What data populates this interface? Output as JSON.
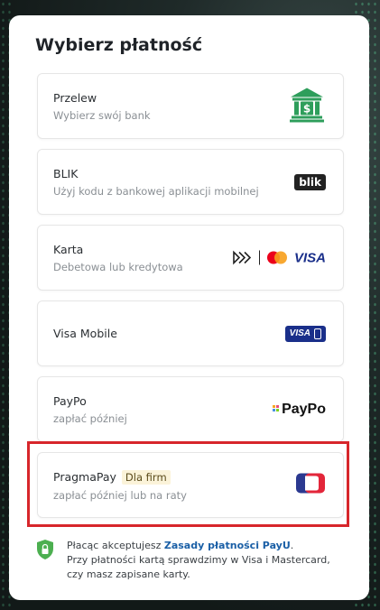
{
  "page": {
    "title": "Wybierz płatność"
  },
  "options": [
    {
      "name": "Przelew",
      "description": "Wybierz swój bank",
      "logo": "bank-icon"
    },
    {
      "name": "BLIK",
      "description": "Użyj kodu z bankowej aplikacji mobilnej",
      "logo": "blik-logo",
      "logo_text": "blik"
    },
    {
      "name": "Karta",
      "description": "Debetowa lub kredytowa",
      "logo": "card-logos",
      "logo_text": "VISA"
    },
    {
      "name": "Visa Mobile",
      "description": "",
      "logo": "visa-mobile-logo",
      "logo_text": "VISA"
    },
    {
      "name": "PayPo",
      "description": "zapłać później",
      "logo": "paypo-logo",
      "logo_text": "PayPo"
    },
    {
      "name": "PragmaPay",
      "badge": "Dla firm",
      "description": "zapłać później lub na raty",
      "logo": "pragmapay-logo"
    }
  ],
  "footer": {
    "prefix": "Płacąc akceptujesz ",
    "link": "Zasady płatności PayU",
    "suffix": ".",
    "line2": "Przy płatności kartą sprawdzimy w Visa i Mastercard, czy masz zapisane karty."
  },
  "colors": {
    "accent_red": "#d7262b",
    "link_blue": "#1a5fa6",
    "bank_green": "#2e9e5b",
    "visa_blue": "#1a2f8a"
  }
}
